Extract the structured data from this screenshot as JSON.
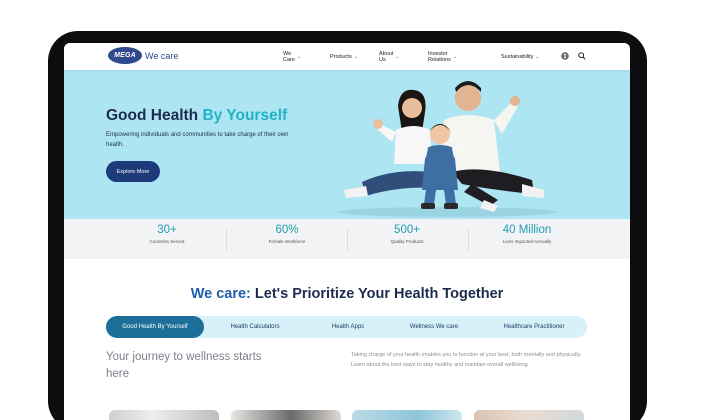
{
  "nav": {
    "logo_badge": "MEGA",
    "logo_text": "We care",
    "menu": [
      {
        "label": "We Care"
      },
      {
        "label": "Products"
      },
      {
        "label": "About Us"
      },
      {
        "label": "Investor Relations"
      },
      {
        "label": "Sustainability"
      }
    ]
  },
  "hero": {
    "title_main": "Good Health ",
    "title_accent": "By Yourself",
    "description": "Empowering individuals and communities to take charge of their own health.",
    "button_label": "Explore More"
  },
  "stats": [
    {
      "value": "30+",
      "label": "Countries Served"
    },
    {
      "value": "60%",
      "label": "Female Workforce"
    },
    {
      "value": "500+",
      "label": "Quality Products"
    },
    {
      "value": "40 Million",
      "label": "Lives Impacted Annually"
    }
  ],
  "section": {
    "title_accent": "We care:",
    "title_main": " Let's Prioritize Your Health Together"
  },
  "tabs": [
    {
      "label": "Good Health By Yourself",
      "active": true
    },
    {
      "label": "Health Calculators",
      "active": false
    },
    {
      "label": "Health Apps",
      "active": false
    },
    {
      "label": "Wellness We care",
      "active": false
    },
    {
      "label": "Healthcare Practitioner",
      "active": false
    }
  ],
  "journey": {
    "heading": "Your journey to wellness starts here",
    "description": "Taking charge of your health enables you to function at your best, both mentally and physically. Learn about the best ways to stay healthy and maintain overall wellbeing."
  },
  "colors": {
    "hero_bg": "#aee5f3",
    "accent_teal": "#22b3c6",
    "navy": "#1d2b4f",
    "button": "#1d3a7a"
  }
}
